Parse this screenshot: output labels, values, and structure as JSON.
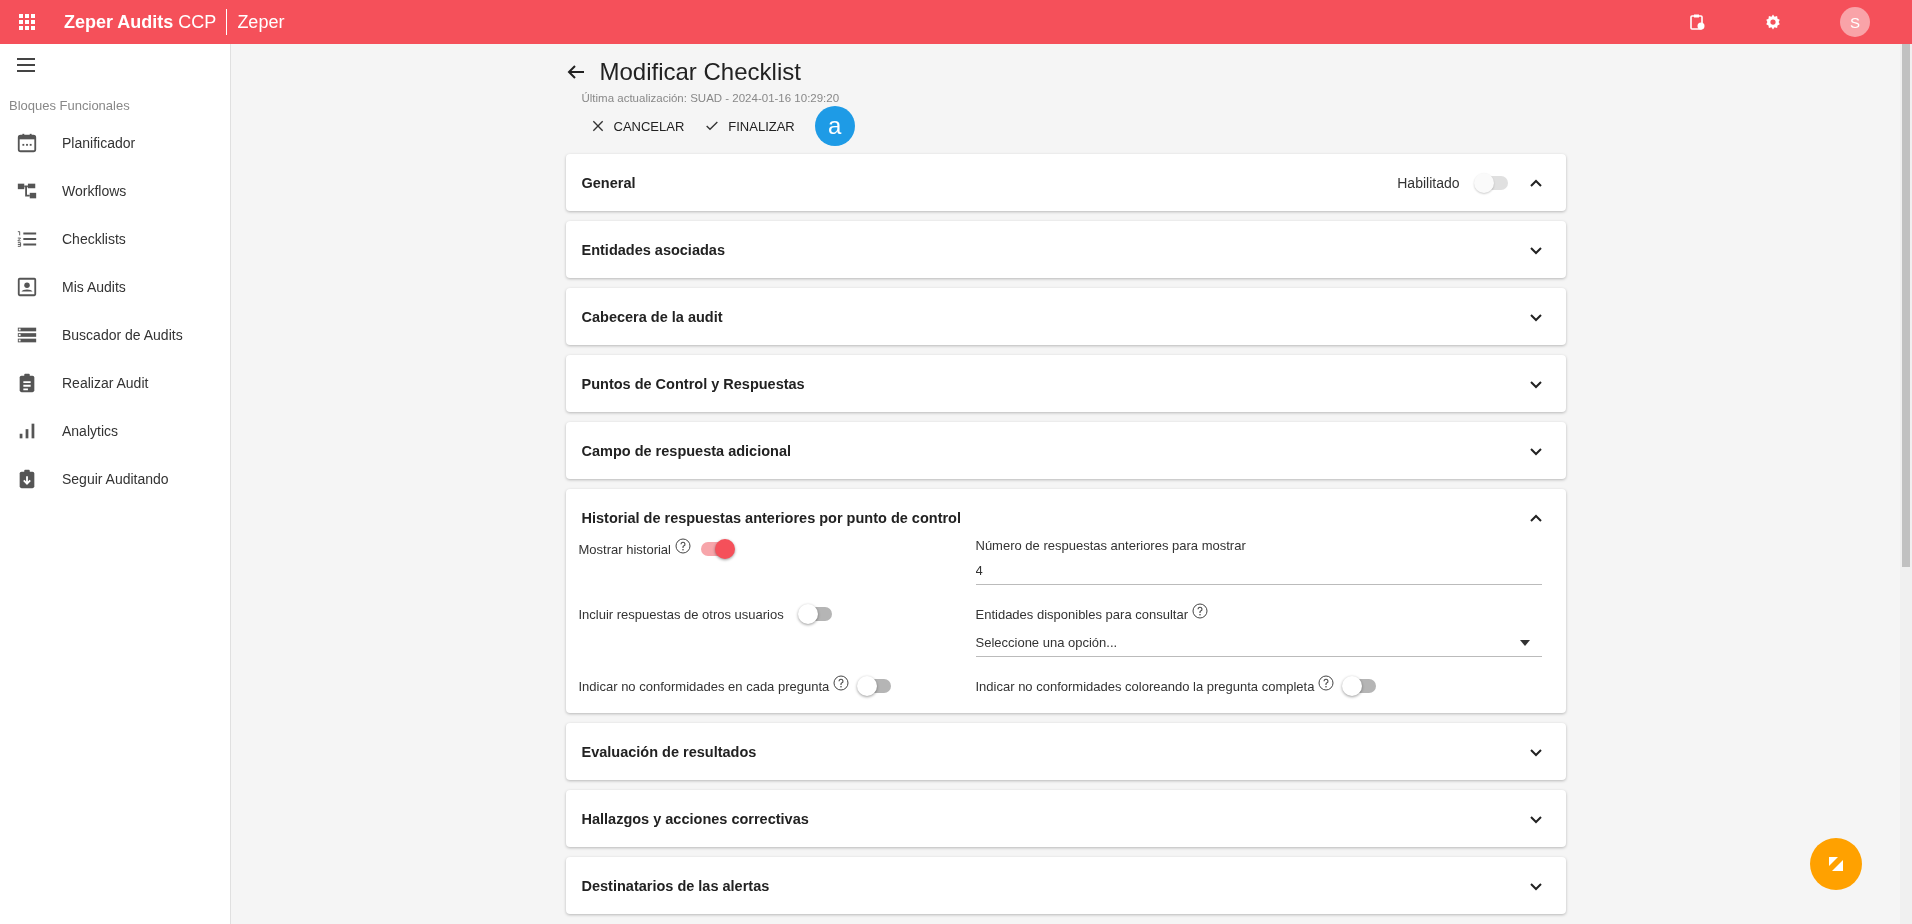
{
  "top_bar": {
    "app_name": "Zeper Audits",
    "app_suffix": "CCP",
    "tenant": "Zeper",
    "avatar_letter": "S"
  },
  "sidebar": {
    "section_title": "Bloques Funcionales",
    "items": [
      {
        "label": "Planificador"
      },
      {
        "label": "Workflows"
      },
      {
        "label": "Checklists"
      },
      {
        "label": "Mis Audits"
      },
      {
        "label": "Buscador de Audits"
      },
      {
        "label": "Realizar Audit"
      },
      {
        "label": "Analytics"
      },
      {
        "label": "Seguir Auditando"
      }
    ]
  },
  "page": {
    "title": "Modificar Checklist",
    "subtitle": "Última actualización: SUAD - 2024-01-16 10:29:20",
    "actions": [
      {
        "label": "CANCELAR"
      },
      {
        "label": "FINALIZAR"
      }
    ],
    "badge": "a"
  },
  "panels": [
    {
      "title": "General",
      "expanded": true,
      "toggle": {
        "label": "Habilitado",
        "on": false,
        "disabled": true
      }
    },
    {
      "title": "Entidades asociadas",
      "expanded": false
    },
    {
      "title": "Cabecera de la audit",
      "expanded": false
    },
    {
      "title": "Puntos de Control y Respuestas",
      "expanded": false
    },
    {
      "title": "Campo de respuesta adicional",
      "expanded": false
    },
    {
      "title": "Historial de respuestas anteriores por punto de control",
      "expanded": true,
      "fields": [
        {
          "kind": "toggle",
          "label": "Mostrar historial",
          "help": true,
          "on": true
        },
        {
          "kind": "text",
          "label": "Número de respuestas anteriores para mostrar",
          "help": false,
          "value": "4"
        },
        {
          "kind": "toggle",
          "label": "Incluir respuestas de otros usuarios",
          "help": false,
          "on": false
        },
        {
          "kind": "select",
          "label": "Entidades disponibles para consultar",
          "help": true,
          "placeholder": "Seleccione una opción..."
        },
        {
          "kind": "toggle",
          "label": "Indicar no conformidades en cada pregunta",
          "help": true,
          "on": false
        },
        {
          "kind": "toggle",
          "label": "Indicar no conformidades coloreando la pregunta completa",
          "help": true,
          "on": false
        }
      ]
    },
    {
      "title": "Evaluación de resultados",
      "expanded": false
    },
    {
      "title": "Hallazgos y acciones correctivas",
      "expanded": false
    },
    {
      "title": "Destinatarios de las alertas",
      "expanded": false
    }
  ]
}
